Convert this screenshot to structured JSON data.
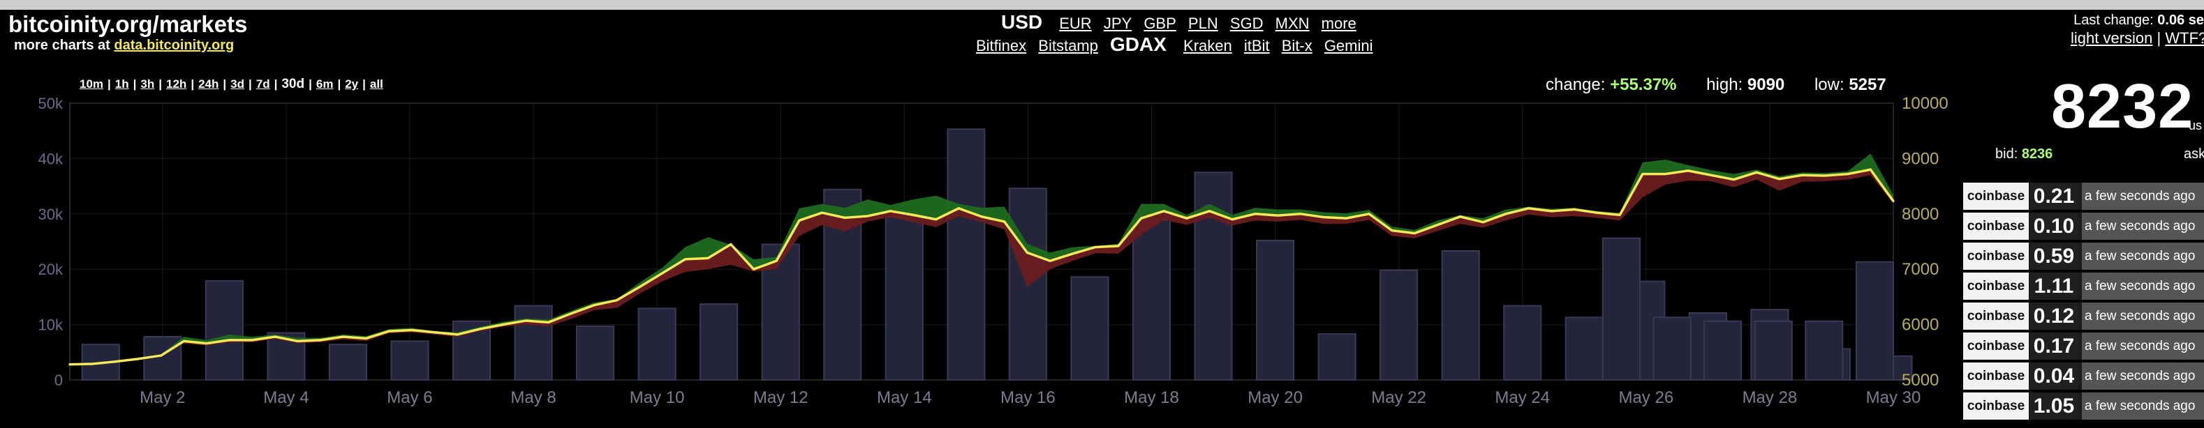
{
  "site": {
    "title": "bitcoinity.org/markets",
    "more_charts_prefix": "more charts at",
    "more_charts_link": "data.bitcoinity.org"
  },
  "currencies": {
    "active": "USD",
    "links": [
      "EUR",
      "JPY",
      "GBP",
      "PLN",
      "SGD",
      "MXN",
      "more"
    ]
  },
  "exchanges": {
    "before": [
      "Bitfinex",
      "Bitstamp"
    ],
    "active": "GDAX",
    "after": [
      "Kraken",
      "itBit",
      "Bit-x",
      "Gemini"
    ]
  },
  "periods": {
    "items": [
      "10m",
      "1h",
      "3h",
      "12h",
      "24h",
      "3d",
      "7d",
      "30d",
      "6m",
      "2y",
      "all"
    ],
    "active": "30d"
  },
  "stats": {
    "change_label": "change:",
    "change": "+55.37%",
    "high_label": "high:",
    "high": "9090",
    "low_label": "low:",
    "low": "5257"
  },
  "status": {
    "last_change_label": "Last change:",
    "last_change_value": "0.06 se",
    "light_version": "light version",
    "wtf": "WTF?"
  },
  "ticker": {
    "price": "8232",
    "unit": "us",
    "bid_label": "bid:",
    "bid": "8236",
    "ask_label": "ask"
  },
  "trades": [
    {
      "exchange": "coinbase",
      "amount": "0.21",
      "time": "a few seconds ago"
    },
    {
      "exchange": "coinbase",
      "amount": "0.10",
      "time": "a few seconds ago"
    },
    {
      "exchange": "coinbase",
      "amount": "0.59",
      "time": "a few seconds ago"
    },
    {
      "exchange": "coinbase",
      "amount": "1.11",
      "time": "a few seconds ago"
    },
    {
      "exchange": "coinbase",
      "amount": "0.12",
      "time": "a few seconds ago"
    },
    {
      "exchange": "coinbase",
      "amount": "0.17",
      "time": "a few seconds ago"
    },
    {
      "exchange": "coinbase",
      "amount": "0.04",
      "time": "a few seconds ago"
    },
    {
      "exchange": "coinbase",
      "amount": "1.05",
      "time": "a few seconds ago"
    }
  ],
  "colors": {
    "price_line": "#f5e85a",
    "up_fill": "#1f6b1f",
    "down_fill": "#6b1e1e",
    "volume_bar": "#24243a",
    "left_axis": "#6b6b8a",
    "right_axis": "#b7ad5c"
  },
  "chart_data": {
    "type": "line",
    "xlabel": "",
    "ylabel": "",
    "grid": true,
    "x_ticks": [
      "May 2",
      "May 4",
      "May 6",
      "May 8",
      "May 10",
      "May 12",
      "May 14",
      "May 16",
      "May 18",
      "May 20",
      "May 22",
      "May 24",
      "May 26",
      "May 28",
      "May 30"
    ],
    "left_axis": {
      "ticks": [
        "0",
        "10k",
        "20k",
        "30k",
        "40k",
        "50k"
      ],
      "range": [
        0,
        50000
      ]
    },
    "right_axis": {
      "ticks": [
        "5000",
        "6000",
        "7000",
        "8000",
        "9000",
        "10000"
      ],
      "range": [
        5000,
        10000
      ]
    },
    "price_series": {
      "name": "",
      "t": [
        0.0,
        0.5,
        1.0,
        1.5,
        2.0,
        2.5,
        3.0,
        3.5,
        4.0,
        4.5,
        5.0,
        5.5,
        6.0,
        6.5,
        7.0,
        7.5,
        8.0,
        8.5,
        9.0,
        9.5,
        10.0,
        10.5,
        11.0,
        11.5,
        12.0,
        12.5,
        13.0,
        13.5,
        14.0,
        14.5,
        15.0,
        15.5,
        16.0,
        16.5,
        17.0,
        17.5,
        18.0,
        18.5,
        19.0,
        19.5,
        20.0,
        20.5,
        21.0,
        21.5,
        22.0,
        22.5,
        23.0,
        23.5,
        24.0,
        24.5,
        25.0,
        25.5,
        26.0,
        26.5,
        27.0,
        27.5,
        28.0,
        28.5,
        29.0,
        29.5
      ],
      "values": [
        5280,
        5290,
        5330,
        5380,
        5440,
        5700,
        5660,
        5720,
        5720,
        5780,
        5700,
        5720,
        5780,
        5750,
        5880,
        5900,
        5860,
        5820,
        5920,
        6000,
        6070,
        6040,
        6200,
        6350,
        6440,
        6680,
        6930,
        7180,
        7200,
        7450,
        7000,
        7150,
        7880,
        8020,
        7930,
        7960,
        8050,
        7980,
        7900,
        8100,
        7950,
        7860,
        7300,
        7150,
        7280,
        7400,
        7420,
        7920,
        8050,
        7920,
        8050,
        7900,
        8000,
        7970,
        8000,
        7940,
        7920,
        8000,
        7700,
        7650,
        7800,
        7950,
        7850,
        8000,
        8100,
        8050,
        8080,
        8020,
        7980,
        8720,
        8720,
        8780,
        8700,
        8620,
        8750,
        8630,
        8700,
        8690,
        8720,
        8800,
        8230
      ],
      "band_high": [
        5280,
        5290,
        5340,
        5400,
        5460,
        5780,
        5720,
        5820,
        5780,
        5820,
        5760,
        5760,
        5820,
        5790,
        5920,
        5940,
        5880,
        5860,
        5960,
        6050,
        6110,
        6090,
        6250,
        6400,
        6460,
        6760,
        7030,
        7400,
        7580,
        7440,
        7180,
        7220,
        8100,
        8180,
        8110,
        8260,
        8160,
        8260,
        8330,
        8180,
        8110,
        8130,
        7460,
        7300,
        7400,
        7420,
        7460,
        8180,
        8180,
        7980,
        8180,
        7980,
        8110,
        8080,
        8080,
        8030,
        8010,
        8070,
        7770,
        7710,
        7880,
        7980,
        7920,
        8080,
        8130,
        8090,
        8110,
        8050,
        8020,
        8930,
        8980,
        8880,
        8790,
        8720,
        8800,
        8680,
        8750,
        8740,
        8770,
        9090,
        8340
      ],
      "band_low": [
        5270,
        5280,
        5320,
        5370,
        5420,
        5660,
        5620,
        5680,
        5680,
        5740,
        5660,
        5680,
        5730,
        5700,
        5840,
        5860,
        5820,
        5780,
        5880,
        5960,
        6000,
        5970,
        6100,
        6260,
        6300,
        6560,
        6780,
        6950,
        7000,
        7080,
        6960,
        7000,
        7600,
        7800,
        7680,
        7860,
        7940,
        7850,
        7760,
        7960,
        7850,
        7720,
        6680,
        7000,
        7150,
        7290,
        7280,
        7620,
        7890,
        7800,
        7930,
        7790,
        7880,
        7860,
        7890,
        7820,
        7820,
        7890,
        7600,
        7560,
        7690,
        7820,
        7750,
        7880,
        7990,
        7940,
        7960,
        7930,
        7880,
        8300,
        8530,
        8600,
        8590,
        8480,
        8620,
        8420,
        8580,
        8590,
        8620,
        8700,
        8190
      ]
    },
    "volume_series": {
      "name": "",
      "t": [
        0.5,
        1.5,
        2.5,
        3.5,
        4.5,
        5.5,
        6.5,
        7.5,
        8.5,
        9.5,
        10.5,
        11.5,
        12.5,
        13.5,
        14.5,
        15.5,
        16.5,
        17.5,
        18.5,
        19.5,
        20.5,
        21.5,
        22.5,
        23.5,
        24.5,
        25.5,
        26.5,
        27.5,
        28.5,
        29.5
      ],
      "values": [
        6400,
        7800,
        17900,
        8500,
        6400,
        7000,
        10600,
        13400,
        9700,
        12900,
        13700,
        24500,
        34400,
        29500,
        45300,
        34600,
        18600,
        28900,
        37500,
        25200,
        8300,
        19800,
        23300,
        13400,
        11300,
        17800,
        12100,
        12700,
        5600,
        4300,
        25600,
        11300,
        10600,
        10600,
        10600,
        21300
      ]
    }
  }
}
